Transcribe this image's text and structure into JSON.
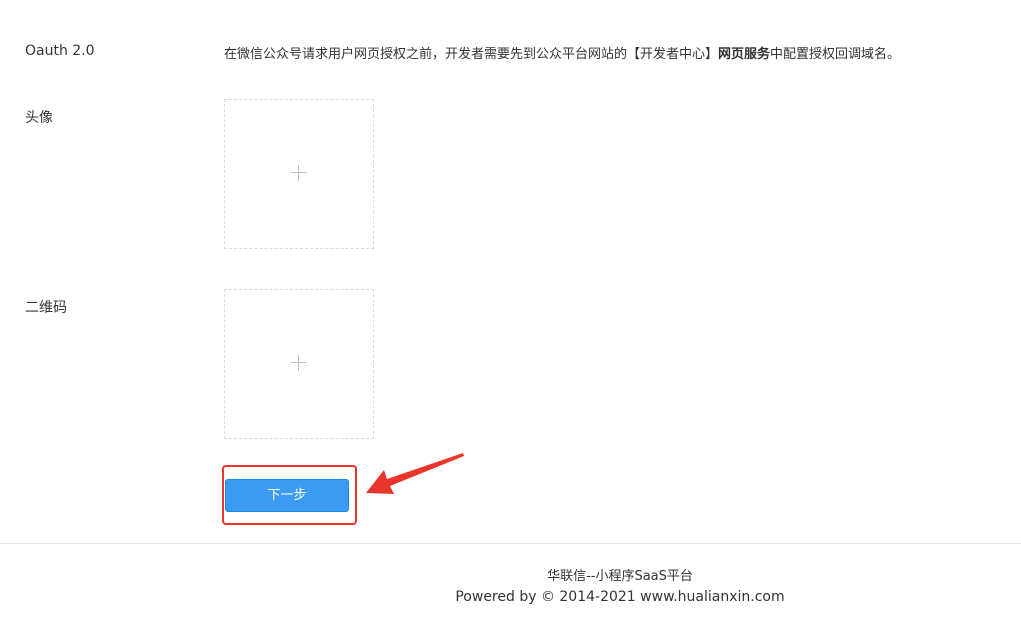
{
  "form": {
    "oauth_label": "Oauth 2.0",
    "oauth_prefix": "在微信公众号请求用户网页授权之前，开发者需要先到公众平台网站的【开发者中心】",
    "oauth_bold": "网页服务",
    "oauth_suffix": "中配置授权回调域名。",
    "avatar_label": "头像",
    "qrcode_label": "二维码",
    "next_button": "下一步"
  },
  "footer": {
    "line1": "华联信--小程序SaaS平台",
    "line2": "Powered by © 2014-2021 www.hualianxin.com"
  },
  "colors": {
    "primary_button": "#3a9bf0",
    "highlight": "#e8362c"
  },
  "icons": {
    "upload": "plus-icon",
    "annotation": "red-arrow"
  }
}
